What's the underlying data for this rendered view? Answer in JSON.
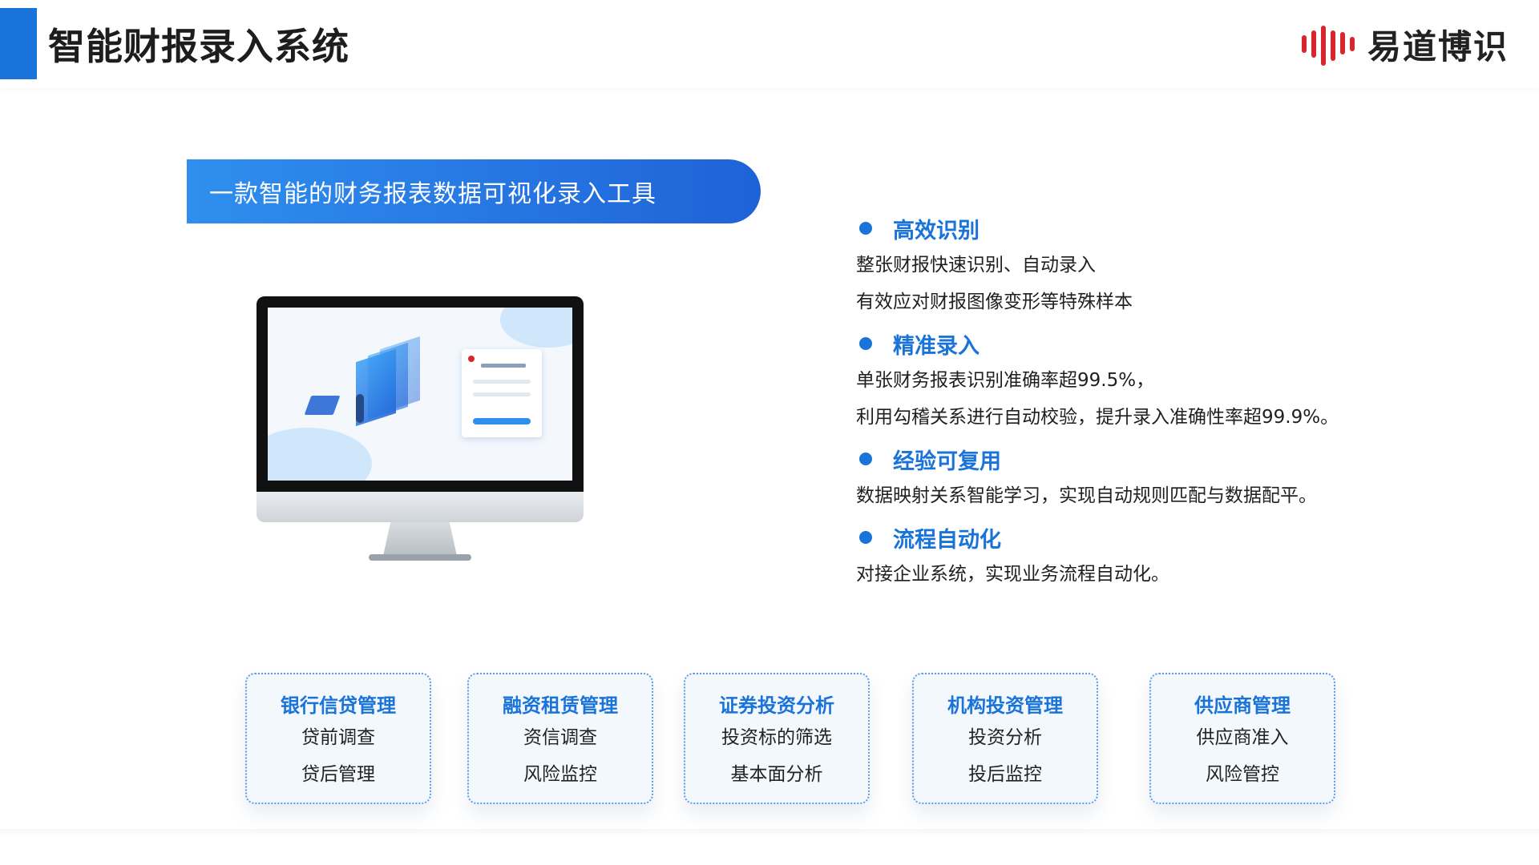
{
  "header": {
    "title": "智能财报录入系统",
    "logo_text": "易道博识"
  },
  "banner": {
    "text": "一款智能的财务报表数据可视化录入工具"
  },
  "features": [
    {
      "title": "高效识别",
      "lines": [
        "整张财报快速识别、自动录入",
        "有效应对财报图像变形等特殊样本"
      ]
    },
    {
      "title": "精准录入",
      "lines": [
        "单张财务报表识别准确率超99.5%，",
        "利用勾稽关系进行自动校验，提升录入准确性率超99.9%。"
      ]
    },
    {
      "title": "经验可复用",
      "lines": [
        "数据映射关系智能学习，实现自动规则匹配与数据配平。"
      ]
    },
    {
      "title": "流程自动化",
      "lines": [
        "对接企业系统，实现业务流程自动化。"
      ]
    }
  ],
  "cards": [
    {
      "title": "银行信贷管理",
      "items": [
        "贷前调查",
        "贷后管理"
      ]
    },
    {
      "title": "融资租赁管理",
      "items": [
        "资信调查",
        "风险监控"
      ]
    },
    {
      "title": "证券投资分析",
      "items": [
        "投资标的筛选",
        "基本面分析"
      ]
    },
    {
      "title": "机构投资管理",
      "items": [
        "投资分析",
        "投后监控"
      ]
    },
    {
      "title": "供应商管理",
      "items": [
        "供应商准入",
        "风险管控"
      ]
    }
  ],
  "colors": {
    "accent": "#1a73d9",
    "logo_red": "#d8262e",
    "banner_start": "#2f8fee",
    "banner_end": "#1f62d8"
  },
  "icons": {
    "logo": "yidao-logo-icon",
    "bullet": "bullet-dot-icon",
    "illustration": "monitor-illustration"
  }
}
